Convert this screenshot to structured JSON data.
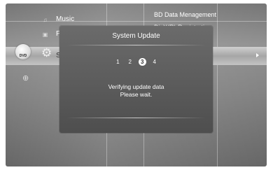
{
  "menu": {
    "items": [
      {
        "label": "Music"
      },
      {
        "label": "Photo"
      },
      {
        "label": "Setup"
      }
    ],
    "disc_label": "DVD",
    "right_options": [
      "BD Data Menagement",
      "DivX(R) Registration"
    ]
  },
  "dialog": {
    "title": "System Update",
    "steps": [
      "1",
      "2",
      "3",
      "4"
    ],
    "active_step": "3",
    "message_line1": "Verifying update data",
    "message_line2": "Please wait."
  }
}
